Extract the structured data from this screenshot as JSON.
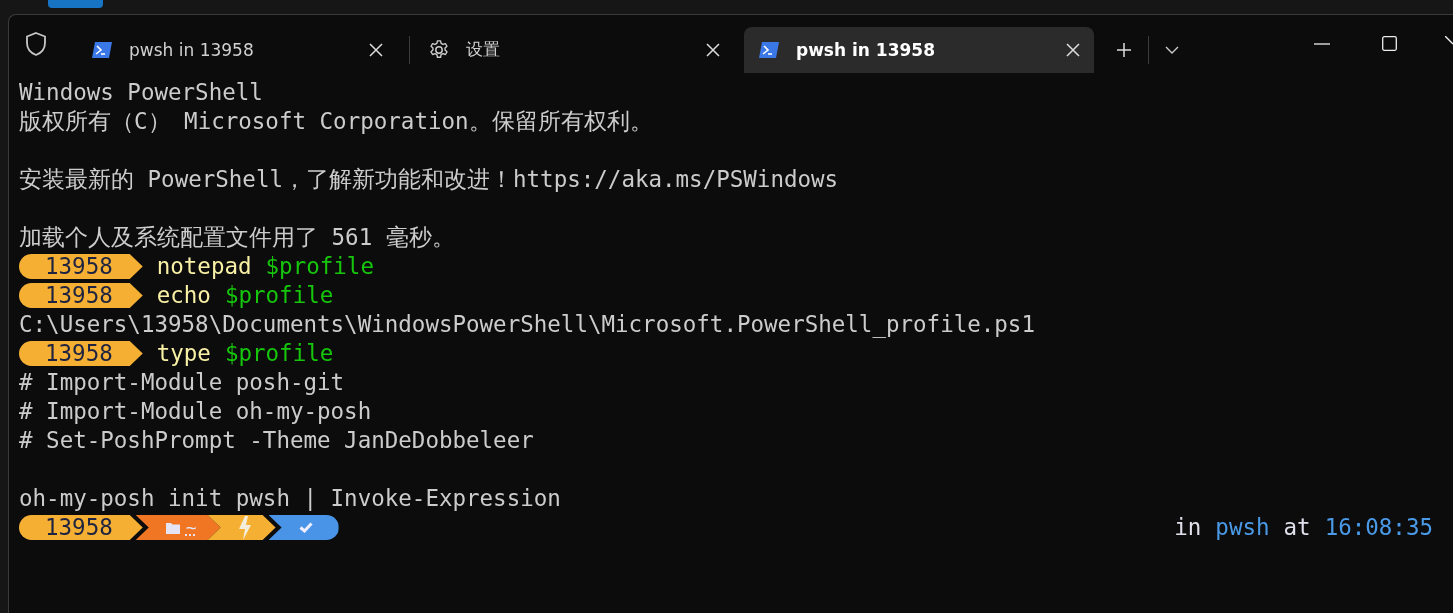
{
  "tabs": [
    {
      "kind": "shell",
      "label": "pwsh in 13958",
      "selected": false
    },
    {
      "kind": "settings",
      "label": "设置",
      "selected": false
    },
    {
      "kind": "shell",
      "label": "pwsh in 13958",
      "selected": true
    }
  ],
  "lines": [
    {
      "kind": "text",
      "text": "Windows PowerShell"
    },
    {
      "kind": "text",
      "text": "版权所有（C） Microsoft Corporation。保留所有权利。"
    },
    {
      "kind": "blank"
    },
    {
      "kind": "text",
      "text": "安装最新的 PowerShell，了解新功能和改进！https://aka.ms/PSWindows"
    },
    {
      "kind": "blank"
    },
    {
      "kind": "text",
      "text": "加载个人及系统配置文件用了 561 毫秒。"
    },
    {
      "kind": "prompt",
      "label": "13958",
      "command": "notepad",
      "argument": "$profile"
    },
    {
      "kind": "prompt",
      "label": "13958",
      "command": "echo",
      "argument": "$profile"
    },
    {
      "kind": "text",
      "text": "C:\\Users\\13958\\Documents\\WindowsPowerShell\\Microsoft.PowerShell_profile.ps1"
    },
    {
      "kind": "prompt",
      "label": "13958",
      "command": "type",
      "argument": "$profile"
    },
    {
      "kind": "text",
      "text": "# Import-Module posh-git"
    },
    {
      "kind": "text",
      "text": "# Import-Module oh-my-posh"
    },
    {
      "kind": "text",
      "text": "# Set-PoshPrompt -Theme JanDeDobbeleer"
    },
    {
      "kind": "blank"
    },
    {
      "kind": "text",
      "text": "oh-my-posh init pwsh | Invoke-Expression"
    }
  ],
  "final_prompt": {
    "segments": [
      {
        "kind": "label",
        "text": "13958",
        "color": "#f5b034"
      },
      {
        "kind": "folder",
        "text": "~",
        "color": "#f07623"
      },
      {
        "kind": "lightning",
        "color": "#f5b034"
      },
      {
        "kind": "check",
        "color": "#4a94e8"
      }
    ],
    "right": {
      "in": "in",
      "shell": "pwsh",
      "at": "at",
      "time": "16:08:35"
    }
  }
}
